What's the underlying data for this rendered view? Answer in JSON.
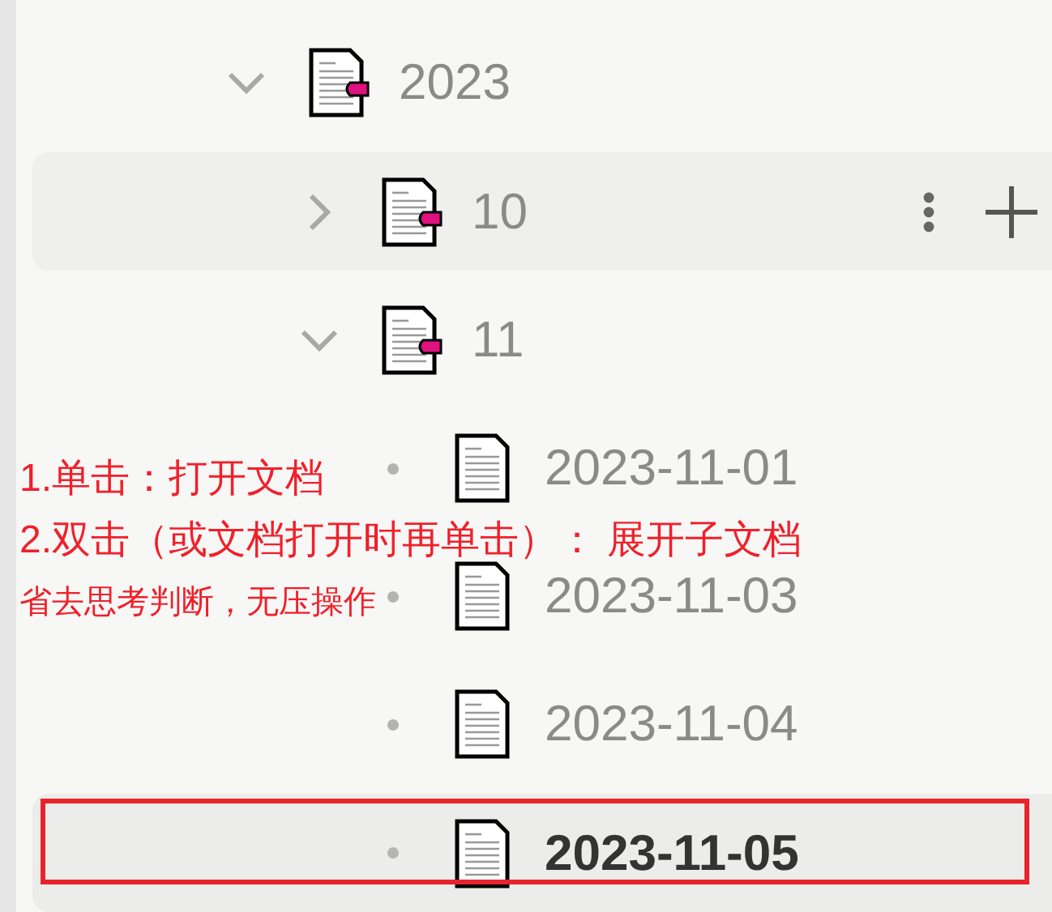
{
  "tree": [
    {
      "label": "2023",
      "kind": "folder",
      "expanded": true,
      "selected": false,
      "hovered": false,
      "children": [
        {
          "label": "10",
          "kind": "folder",
          "expanded": false,
          "selected": false,
          "hovered": true
        },
        {
          "label": "11",
          "kind": "folder",
          "expanded": true,
          "selected": false,
          "hovered": false,
          "children": [
            {
              "label": "2023-11-01",
              "kind": "leaf",
              "selected": false,
              "hovered": false
            },
            {
              "label": "2023-11-03",
              "kind": "leaf",
              "selected": false,
              "hovered": false
            },
            {
              "label": "2023-11-04",
              "kind": "leaf",
              "selected": false,
              "hovered": false
            },
            {
              "label": "2023-11-05",
              "kind": "leaf",
              "selected": true,
              "hovered": false,
              "boxed": true
            }
          ]
        }
      ]
    }
  ],
  "annotation": {
    "lines": [
      "1.单击：打开文档",
      "2.双击（或文档打开时再单击）： 展开子文档",
      "省去思考判断，无压操作"
    ]
  }
}
